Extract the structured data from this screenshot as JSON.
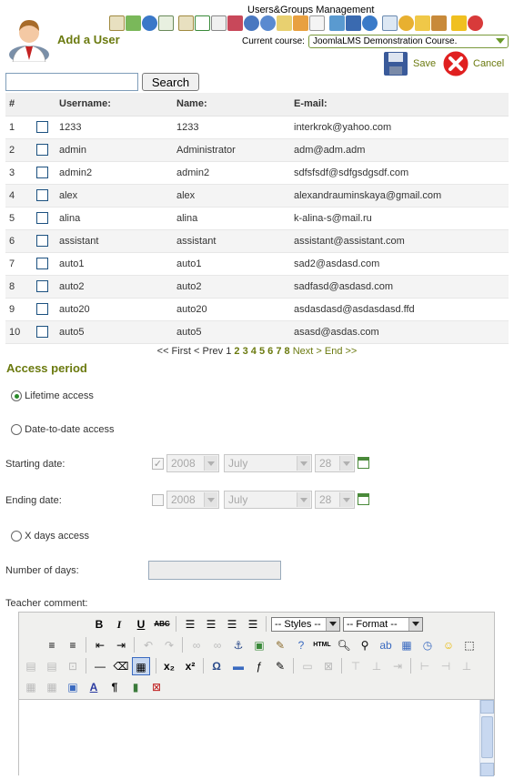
{
  "header": {
    "module_title": "Users&Groups Management",
    "page_heading": "Add a User",
    "course_label": "Current course:",
    "course_value": "JoomlaLMS Demonstration Course.",
    "save_label": "Save",
    "cancel_label": "Cancel",
    "toolbar_icons": [
      "home-icon",
      "chalkboard-icon",
      "info-icon",
      "documents-icon",
      "home-icon",
      "calendar-icon",
      "copy-icon",
      "tag-icon",
      "web-icon",
      "help-icon",
      "chat-icon",
      "pencil-icon",
      "page-icon",
      "users-icon",
      "stats-icon",
      "globe-icon",
      "search-doc-icon",
      "chart-icon",
      "mail-icon",
      "people-icon",
      "star-icon",
      "zoom-icon"
    ]
  },
  "search": {
    "button_label": "Search",
    "value": ""
  },
  "table": {
    "headers": {
      "num": "#",
      "username": "Username:",
      "name": "Name:",
      "email": "E-mail:"
    },
    "rows": [
      {
        "num": "1",
        "username": "1233",
        "name": "1233",
        "email": "interkrok@yahoo.com"
      },
      {
        "num": "2",
        "username": "admin",
        "name": "Administrator",
        "email": "adm@adm.adm"
      },
      {
        "num": "3",
        "username": "admin2",
        "name": "admin2",
        "email": "sdfsfsdf@sdfgsdgsdf.com"
      },
      {
        "num": "4",
        "username": "alex",
        "name": "alex",
        "email": "alexandrauminskaya@gmail.com"
      },
      {
        "num": "5",
        "username": "alina",
        "name": "alina",
        "email": "k-alina-s@mail.ru"
      },
      {
        "num": "6",
        "username": "assistant",
        "name": "assistant",
        "email": "assistant@assistant.com"
      },
      {
        "num": "7",
        "username": "auto1",
        "name": "auto1",
        "email": "sad2@asdasd.com"
      },
      {
        "num": "8",
        "username": "auto2",
        "name": "auto2",
        "email": "sadfasd@asdasd.com"
      },
      {
        "num": "9",
        "username": "auto20",
        "name": "auto20",
        "email": "asdasdasd@asdasdasd.ffd"
      },
      {
        "num": "10",
        "username": "auto5",
        "name": "auto5",
        "email": "asasd@asdas.com"
      }
    ]
  },
  "pagination": {
    "first": "<< First",
    "prev": "< Prev",
    "current": "1",
    "pages": [
      "2",
      "3",
      "4",
      "5",
      "6",
      "7",
      "8"
    ],
    "next": "Next >",
    "end": "End >>"
  },
  "access": {
    "heading": "Access period",
    "lifetime_label": "Lifetime access",
    "date_to_date_label": "Date-to-date access",
    "starting_label": "Starting date:",
    "ending_label": "Ending date:",
    "start_year": "2008",
    "start_month": "July",
    "start_day": "28",
    "end_year": "2008",
    "end_month": "July",
    "end_day": "28",
    "xdays_label": "X days access",
    "days_label": "Number of days:",
    "teacher_label": "Teacher comment:",
    "selected": "lifetime"
  },
  "editor": {
    "styles_label": "-- Styles --",
    "format_label": "-- Format --"
  },
  "colors": {
    "accent": "#6b7a0f",
    "row_alt": "#f4f4f4"
  }
}
